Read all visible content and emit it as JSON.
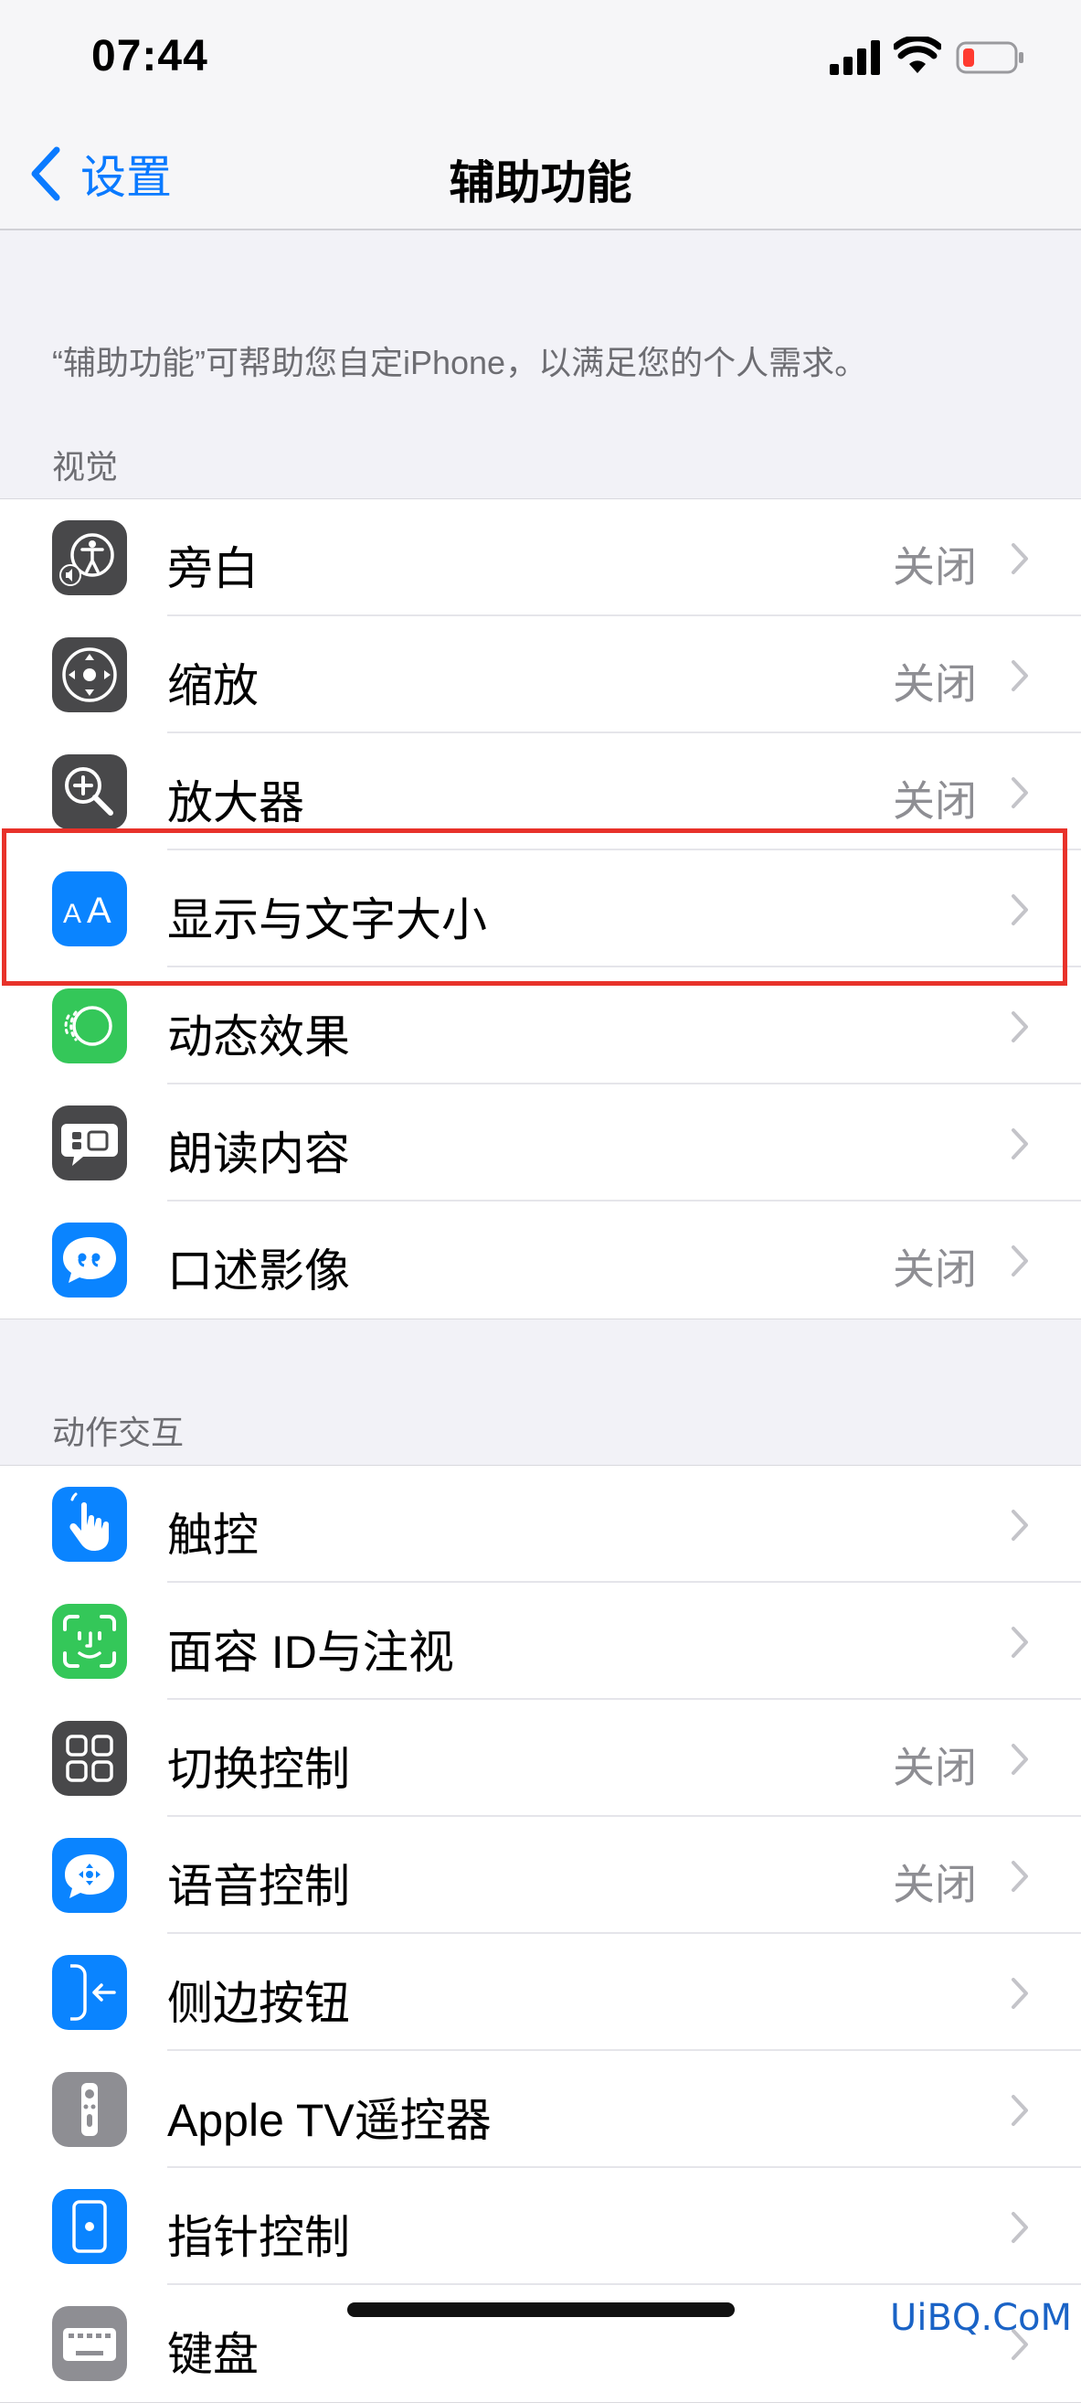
{
  "status_bar": {
    "time": "07:44"
  },
  "nav": {
    "back_label": "设置",
    "title": "辅助功能"
  },
  "intro": "“辅助功能”可帮助您自定iPhone，以满足您的个人需求。",
  "sections": [
    {
      "header": "视觉",
      "items": [
        {
          "label": "旁白",
          "value": "关闭",
          "icon": "voiceover-icon",
          "color": "#48484a"
        },
        {
          "label": "缩放",
          "value": "关闭",
          "icon": "zoom-icon",
          "color": "#48484a"
        },
        {
          "label": "放大器",
          "value": "关闭",
          "icon": "magnifier-icon",
          "color": "#48484a"
        },
        {
          "label": "显示与文字大小",
          "value": "",
          "icon": "display-text-size-icon",
          "color": "#0a84ff"
        },
        {
          "label": "动态效果",
          "value": "",
          "icon": "motion-icon",
          "color": "#34c759"
        },
        {
          "label": "朗读内容",
          "value": "",
          "icon": "spoken-content-icon",
          "color": "#48484a"
        },
        {
          "label": "口述影像",
          "value": "关闭",
          "icon": "audio-descriptions-icon",
          "color": "#0a84ff"
        }
      ]
    },
    {
      "header": "动作交互",
      "items": [
        {
          "label": "触控",
          "value": "",
          "icon": "touch-icon",
          "color": "#0a84ff"
        },
        {
          "label": "面容 ID与注视",
          "value": "",
          "icon": "face-id-icon",
          "color": "#34c759"
        },
        {
          "label": "切换控制",
          "value": "关闭",
          "icon": "switch-control-icon",
          "color": "#48484a"
        },
        {
          "label": "语音控制",
          "value": "关闭",
          "icon": "voice-control-icon",
          "color": "#0a84ff"
        },
        {
          "label": "侧边按钮",
          "value": "",
          "icon": "side-button-icon",
          "color": "#0a84ff"
        },
        {
          "label": "Apple TV遥控器",
          "value": "",
          "icon": "apple-tv-remote-icon",
          "color": "#8e8e93"
        },
        {
          "label": "指针控制",
          "value": "",
          "icon": "pointer-control-icon",
          "color": "#0a84ff"
        },
        {
          "label": "键盘",
          "value": "",
          "icon": "keyboard-icon",
          "color": "#8e8e93"
        }
      ]
    }
  ],
  "watermark": "UiBQ.CoM"
}
